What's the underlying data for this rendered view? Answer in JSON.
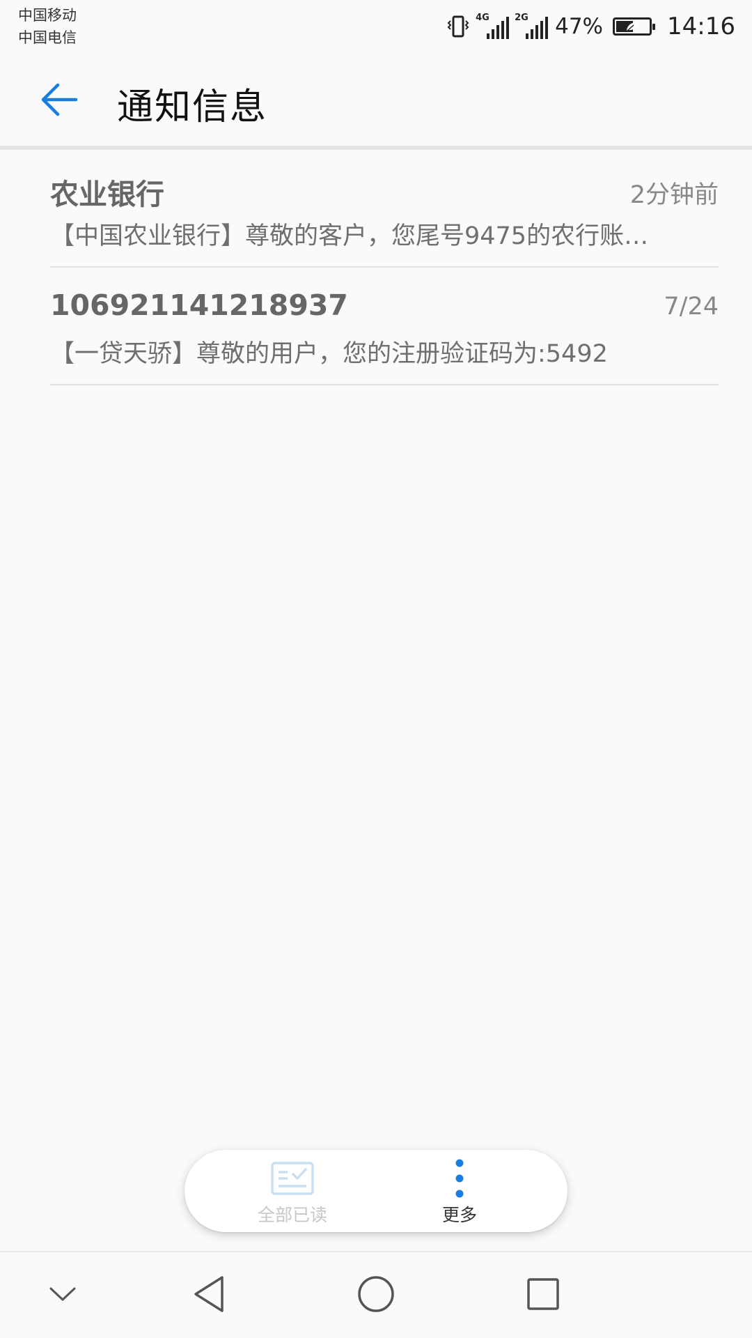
{
  "status_bar": {
    "carrier_1": "中国移动",
    "carrier_2": "中国电信",
    "icons": [
      "vibrate-icon",
      "signal-4g-icon",
      "signal-2g-icon",
      "battery-icon"
    ],
    "network_1": "4G",
    "network_2": "2G",
    "battery_percent_text": "47%",
    "battery_level": 0.47,
    "time": "14:16"
  },
  "header": {
    "back_icon": "arrow-left-icon",
    "title": "通知信息",
    "accent_color": "#1a7ee0"
  },
  "messages": [
    {
      "sender": "农业银行",
      "time": "2分钟前",
      "preview": "【中国农业银行】尊敬的客户，您尾号9475的农行账…"
    },
    {
      "sender": "106921141218937",
      "time": "7/24",
      "preview": "【一贷天骄】尊敬的用户，您的注册验证码为:5492"
    }
  ],
  "actions": {
    "mark_all_read": {
      "label": "全部已读",
      "icon": "mark-all-read-icon",
      "enabled": false
    },
    "more": {
      "label": "更多",
      "icon": "more-vertical-icon"
    }
  },
  "nav_bar": {
    "icons": [
      "chevron-down-icon",
      "back-triangle-icon",
      "home-circle-icon",
      "recents-square-icon"
    ]
  }
}
